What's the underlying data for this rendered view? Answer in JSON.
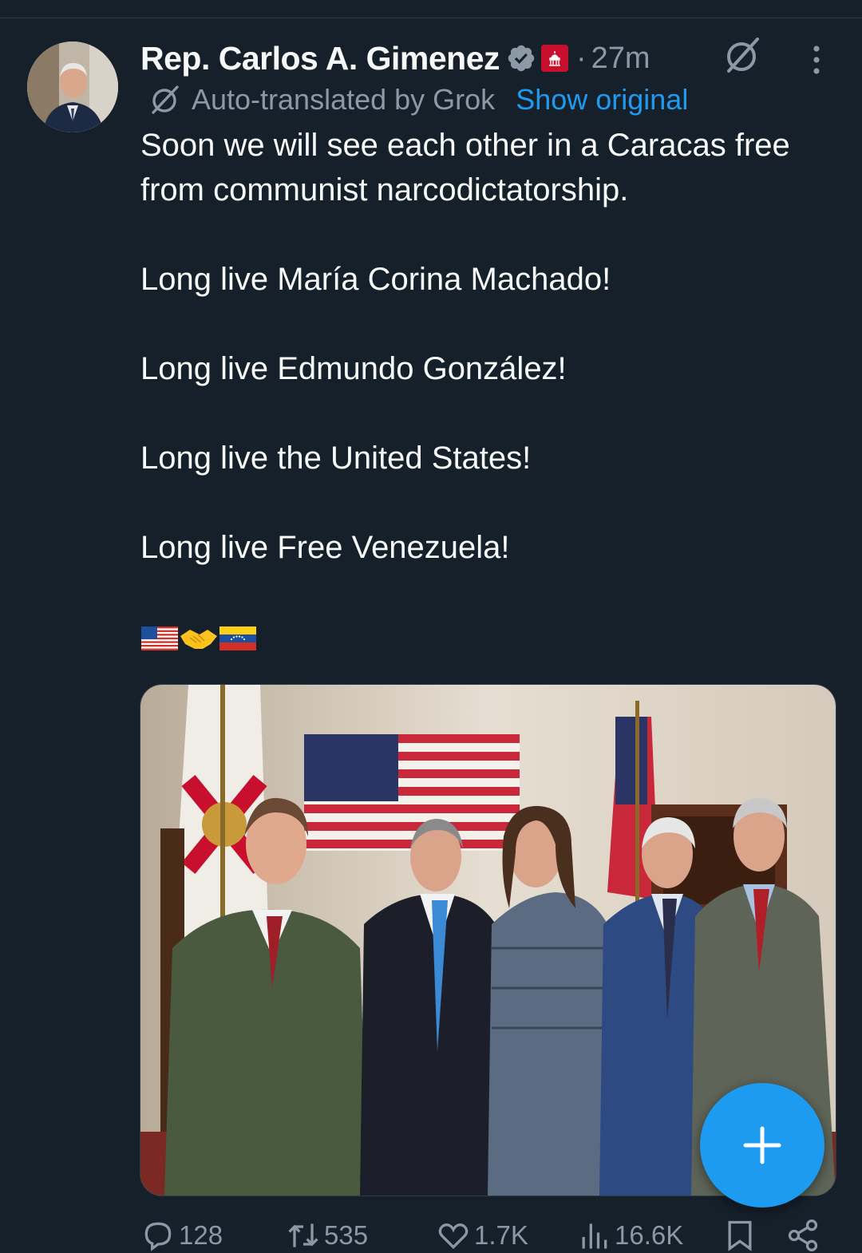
{
  "tweet": {
    "author_name": "Rep. Carlos A. Gimenez",
    "separator": "·",
    "time": "27m",
    "translation_note": "Auto-translated by Grok",
    "show_original_label": "Show original",
    "lines": [
      "Soon we will see each other in a Caracas free from communist narcodictatorship.",
      "Long live María Corina Machado!",
      "Long live Edmundo González!",
      "Long live the United States!",
      "Long live Free Venezuela!"
    ],
    "emojis": [
      "us-flag",
      "handshake",
      "venezuela-flag"
    ]
  },
  "actions": {
    "replies": "128",
    "reposts": "535",
    "likes": "1.7K",
    "views": "16.6K"
  },
  "colors": {
    "background": "#15202b",
    "text_primary": "#f7f9f9",
    "text_secondary": "#8b98a5",
    "accent": "#1d9bf0",
    "verified": "#8b98a5",
    "gov_badge": "#c8102e"
  },
  "icons": [
    "grok-icon",
    "more-icon",
    "verified-icon",
    "gov-badge-icon",
    "reply-icon",
    "repost-icon",
    "like-icon",
    "views-icon",
    "bookmark-icon",
    "share-icon",
    "compose-plus-icon"
  ]
}
